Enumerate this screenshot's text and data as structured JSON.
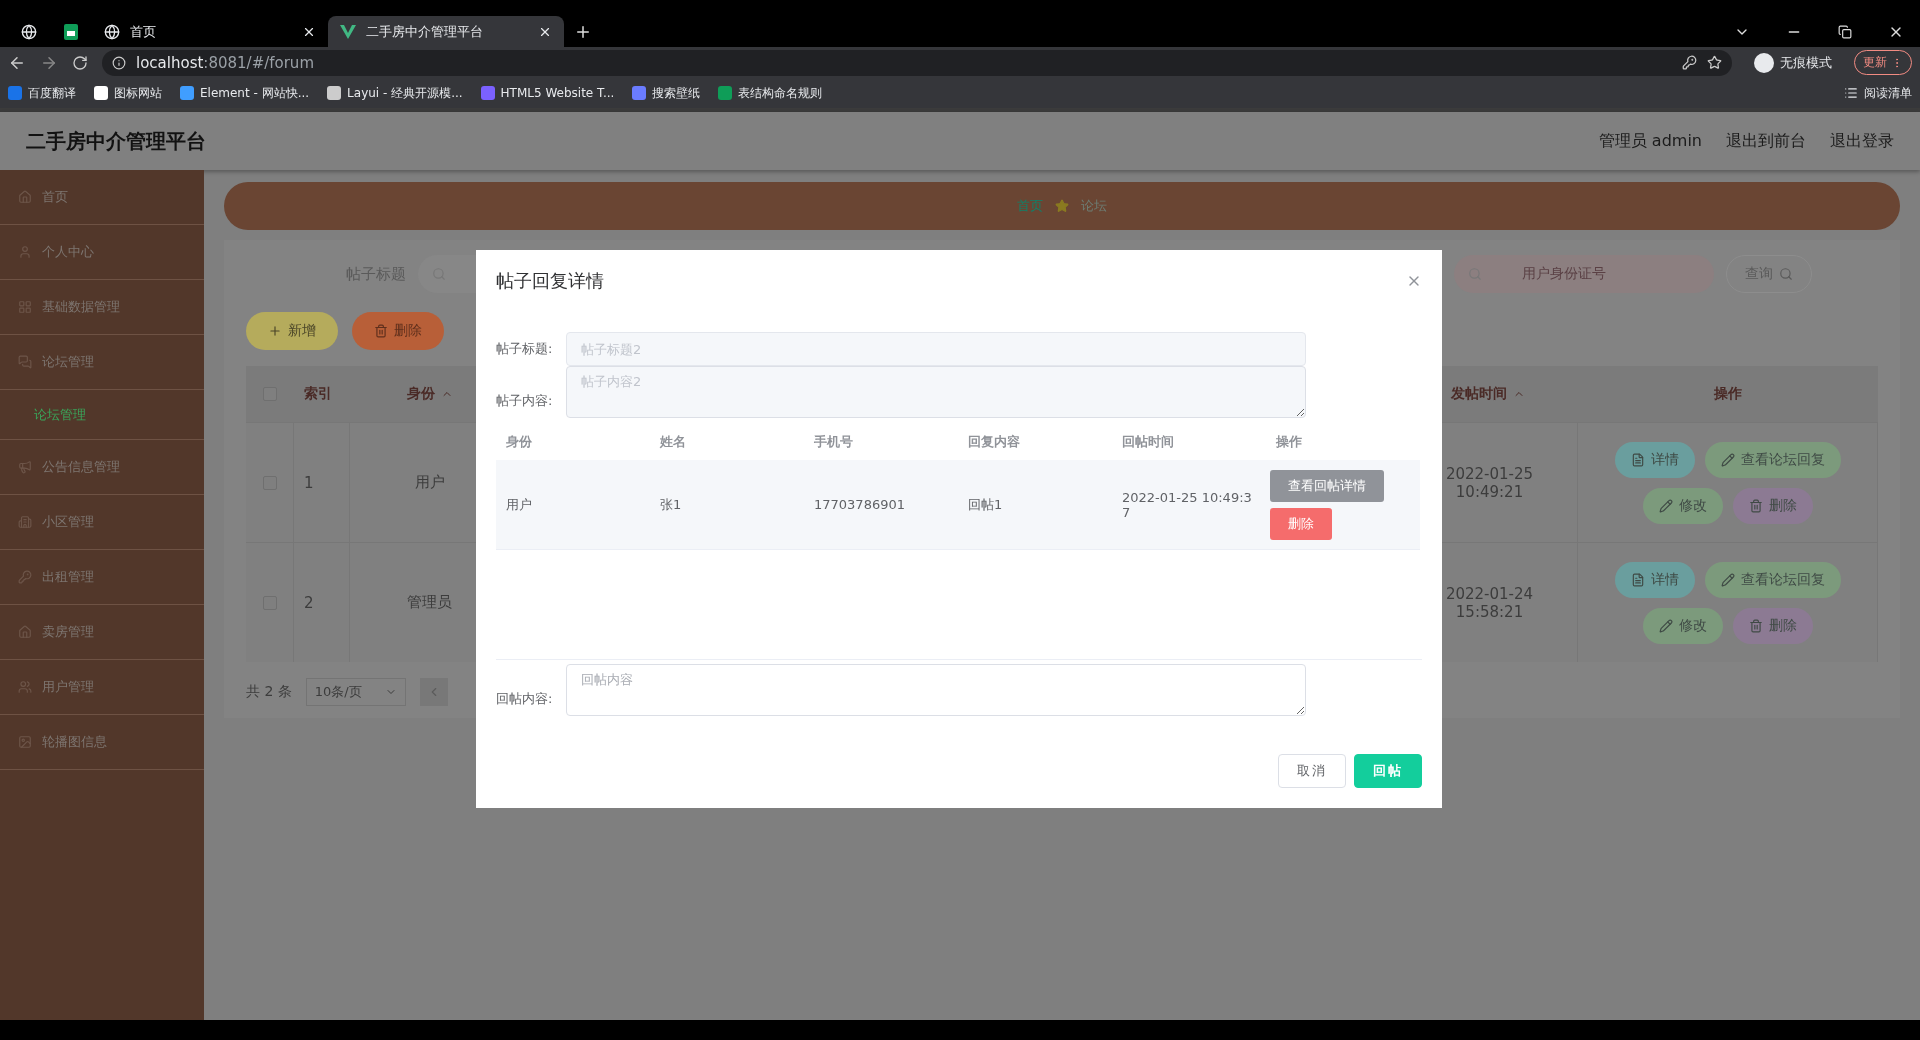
{
  "browser": {
    "tabs": [
      {
        "kind": "pinned",
        "selected": false
      },
      {
        "kind": "pinned",
        "selected": false
      },
      {
        "kind": "page",
        "title": "首页",
        "selected": false
      },
      {
        "kind": "page",
        "title": "二手房中介管理平台",
        "selected": true
      }
    ],
    "url_host": "localhost",
    "url_path": ":8081/#/forum",
    "profile": "无痕模式",
    "update": "更新",
    "bookmarks": [
      "百度翻译",
      "图标网站",
      "Element - 网站快...",
      "Layui - 经典开源模...",
      "HTML5 Website T...",
      "搜索壁纸",
      "表结构命名规则"
    ],
    "reading_list": "阅读清单"
  },
  "header": {
    "title": "二手房中介管理平台",
    "links": [
      "管理员 admin",
      "退出到前台",
      "退出登录"
    ]
  },
  "sidebar": {
    "items": [
      {
        "label": "首页",
        "selected": false
      },
      {
        "label": "个人中心",
        "selected": false
      },
      {
        "label": "基础数据管理",
        "selected": false
      },
      {
        "label": "论坛管理",
        "selected": false,
        "children": [
          {
            "label": "论坛管理",
            "selected": true
          }
        ]
      },
      {
        "label": "公告信息管理",
        "selected": false
      },
      {
        "label": "小区管理",
        "selected": false
      },
      {
        "label": "出租管理",
        "selected": false
      },
      {
        "label": "卖房管理",
        "selected": false
      },
      {
        "label": "用户管理",
        "selected": false
      },
      {
        "label": "轮播图信息",
        "selected": false
      }
    ]
  },
  "breadcrumb": [
    "首页",
    "论坛"
  ],
  "search": {
    "label": "帖子标题",
    "id_placeholder": "用户身份证号",
    "button": "查询"
  },
  "toolbar": [
    {
      "kind": "add",
      "label": "新增"
    },
    {
      "kind": "delete",
      "label": "删除"
    }
  ],
  "table": {
    "columns": [
      "索引",
      "身份",
      "发帖时间",
      "操作"
    ],
    "rows": [
      {
        "checked": false,
        "index": "1",
        "role": "用户",
        "time": "2022-01-25 10:49:21",
        "actions": [
          "详情",
          "查看论坛回复",
          "修改",
          "删除"
        ]
      },
      {
        "checked": false,
        "index": "2",
        "role": "管理员",
        "time": "2022-01-24 15:58:21",
        "actions": [
          "详情",
          "查看论坛回复",
          "修改",
          "删除"
        ]
      }
    ],
    "header_checked": false
  },
  "pagination": {
    "total": "共 2 条",
    "page_size": "10条/页"
  },
  "dialog": {
    "title": "帖子回复详情",
    "fields": [
      {
        "label": "帖子标题:",
        "placeholder": "帖子标题2",
        "disabled": true,
        "kind": "input"
      },
      {
        "label": "帖子内容:",
        "placeholder": "帖子内容2",
        "disabled": true,
        "kind": "textarea"
      }
    ],
    "columns": [
      "身份",
      "姓名",
      "手机号",
      "回复内容",
      "回帖时间",
      "操作"
    ],
    "rows": [
      {
        "cells": [
          "用户",
          "张1",
          "17703786901",
          "回帖1",
          "2022-01-25 10:49:37"
        ],
        "actions": [
          {
            "kind": "info",
            "label": "查看回帖详情"
          },
          {
            "kind": "danger",
            "label": "删除"
          }
        ]
      }
    ],
    "reply": {
      "label": "回帖内容:",
      "placeholder": "回帖内容",
      "disabled": false
    },
    "buttons": [
      {
        "kind": "default",
        "label": "取消"
      },
      {
        "kind": "primary",
        "label": "回帖"
      }
    ]
  }
}
